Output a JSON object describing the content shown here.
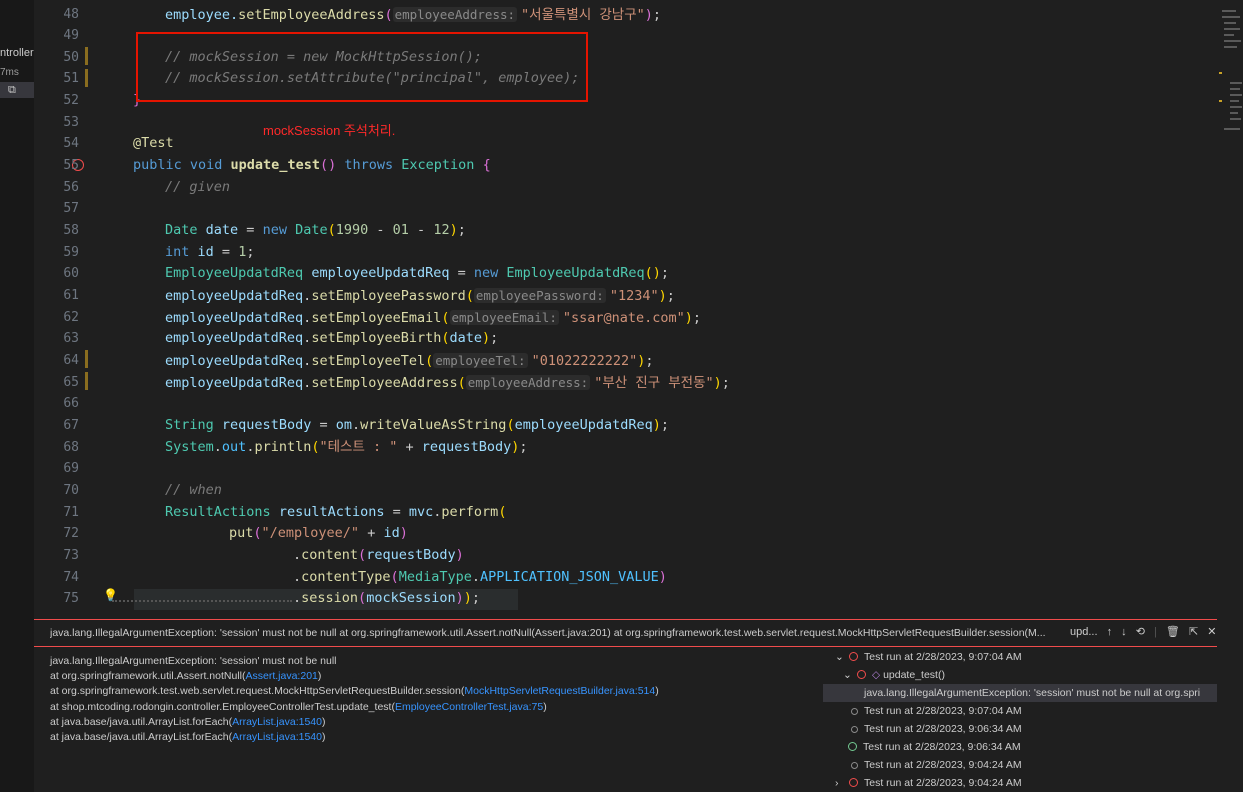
{
  "sidebar": {
    "text1": "ntroller",
    "text2": "7ms"
  },
  "editor": {
    "lines": [
      {
        "n": "48"
      },
      {
        "n": "49"
      },
      {
        "n": "50"
      },
      {
        "n": "51"
      },
      {
        "n": "52"
      },
      {
        "n": "53"
      },
      {
        "n": "54"
      },
      {
        "n": "55"
      },
      {
        "n": "56"
      },
      {
        "n": "57"
      },
      {
        "n": "58"
      },
      {
        "n": "59"
      },
      {
        "n": "60"
      },
      {
        "n": "61"
      },
      {
        "n": "62"
      },
      {
        "n": "63"
      },
      {
        "n": "64"
      },
      {
        "n": "65"
      },
      {
        "n": "66"
      },
      {
        "n": "67"
      },
      {
        "n": "68"
      },
      {
        "n": "69"
      },
      {
        "n": "70"
      },
      {
        "n": "71"
      },
      {
        "n": "72"
      },
      {
        "n": "73"
      },
      {
        "n": "74"
      },
      {
        "n": "75"
      }
    ],
    "annotation": "mockSession 주석처리."
  },
  "peek": {
    "title": "java.lang.IllegalArgumentException: 'session' must not be null at org.springframework.util.Assert.notNull(Assert.java:201) at org.springframework.test.web.servlet.request.MockHttpServletRequestBuilder.session(M...",
    "tab": "upd...",
    "trace": [
      {
        "pre": "java.lang.IllegalArgumentException: 'session' must not be null",
        "link": "",
        "post": ""
      },
      {
        "pre": " at org.springframework.util.Assert.notNull(",
        "link": "Assert.java:201",
        "post": ")"
      },
      {
        "pre": " at org.springframework.test.web.servlet.request.MockHttpServletRequestBuilder.session(",
        "link": "MockHttpServletRequestBuilder.java:514",
        "post": ")"
      },
      {
        "pre": " at shop.mtcoding.rodongin.controller.EmployeeControllerTest.update_test(",
        "link": "EmployeeControllerTest.java:75",
        "post": ")"
      },
      {
        "pre": " at java.base/java.util.ArrayList.forEach(",
        "link": "ArrayList.java:1540",
        "post": ")"
      },
      {
        "pre": " at java.base/java.util.ArrayList.forEach(",
        "link": "ArrayList.java:1540",
        "post": ")"
      }
    ],
    "runs": [
      {
        "label": "Test run at 2/28/2023, 9:07:04 AM"
      },
      {
        "label": "update_test()"
      },
      {
        "label": "java.lang.IllegalArgumentException: 'session' must not be null at org.spri"
      },
      {
        "label": "Test run at 2/28/2023, 9:07:04 AM"
      },
      {
        "label": "Test run at 2/28/2023, 9:06:34 AM"
      },
      {
        "label": "Test run at 2/28/2023, 9:06:34 AM"
      },
      {
        "label": "Test run at 2/28/2023, 9:04:24 AM"
      },
      {
        "label": "Test run at 2/28/2023, 9:04:24 AM"
      }
    ]
  },
  "code": {
    "l48a": "employee.",
    "l48b": "setEmployeeAddress",
    "l48h": "employeeAddress:",
    "l48s": "\"서울특별시 강남구\"",
    "l50": "// mockSession = new MockHttpSession();",
    "l51": "// mockSession.setAttribute(\"principal\", employee);",
    "l54": "@Test",
    "l55k": "public void",
    "l55f": "update_test",
    "l55t": "throws",
    "l55e": "Exception",
    "l56": "// given",
    "l58t": "Date",
    "l58v": "date",
    "l58n": "new",
    "l58c": "Date",
    "l58a": "1990",
    "l58b": "01",
    "l58d": "12",
    "l59k": "int",
    "l59v": "id",
    "l59n": "1",
    "l60t": "EmployeeUpdatdReq",
    "l60v": "employeeUpdatdReq",
    "l60n": "new",
    "l60c": "EmployeeUpdatdReq",
    "obj": "employeeUpdatdReq",
    "l61f": "setEmployeePassword",
    "l61h": "employeePassword:",
    "l61s": "\"1234\"",
    "l62f": "setEmployeeEmail",
    "l62h": "employeeEmail:",
    "l62s": "\"ssar@nate.com\"",
    "l63f": "setEmployeeBirth",
    "l63a": "date",
    "l64f": "setEmployeeTel",
    "l64h": "employeeTel:",
    "l64s": "\"01022222222\"",
    "l65f": "setEmployeeAddress",
    "l65h": "employeeAddress:",
    "l65s": "\"부산 진구 부전동\"",
    "l67t": "String",
    "l67v": "requestBody",
    "l67o": "om",
    "l67f": "writeValueAsString",
    "l67a": "employeeUpdatdReq",
    "l68c": "System",
    "l68o": "out",
    "l68f": "println",
    "l68s": "\"테스트 : \"",
    "l68a": "requestBody",
    "l70": "// when",
    "l71t": "ResultActions",
    "l71v": "resultActions",
    "l71o": "mvc",
    "l71f": "perform",
    "l72f": "put",
    "l72s": "\"/employee/\"",
    "l72a": "id",
    "l73f": "content",
    "l73a": "requestBody",
    "l74f": "contentType",
    "l74c": "MediaType",
    "l74k": "APPLICATION_JSON_VALUE",
    "l75f": "session",
    "l75a": "mockSession"
  }
}
